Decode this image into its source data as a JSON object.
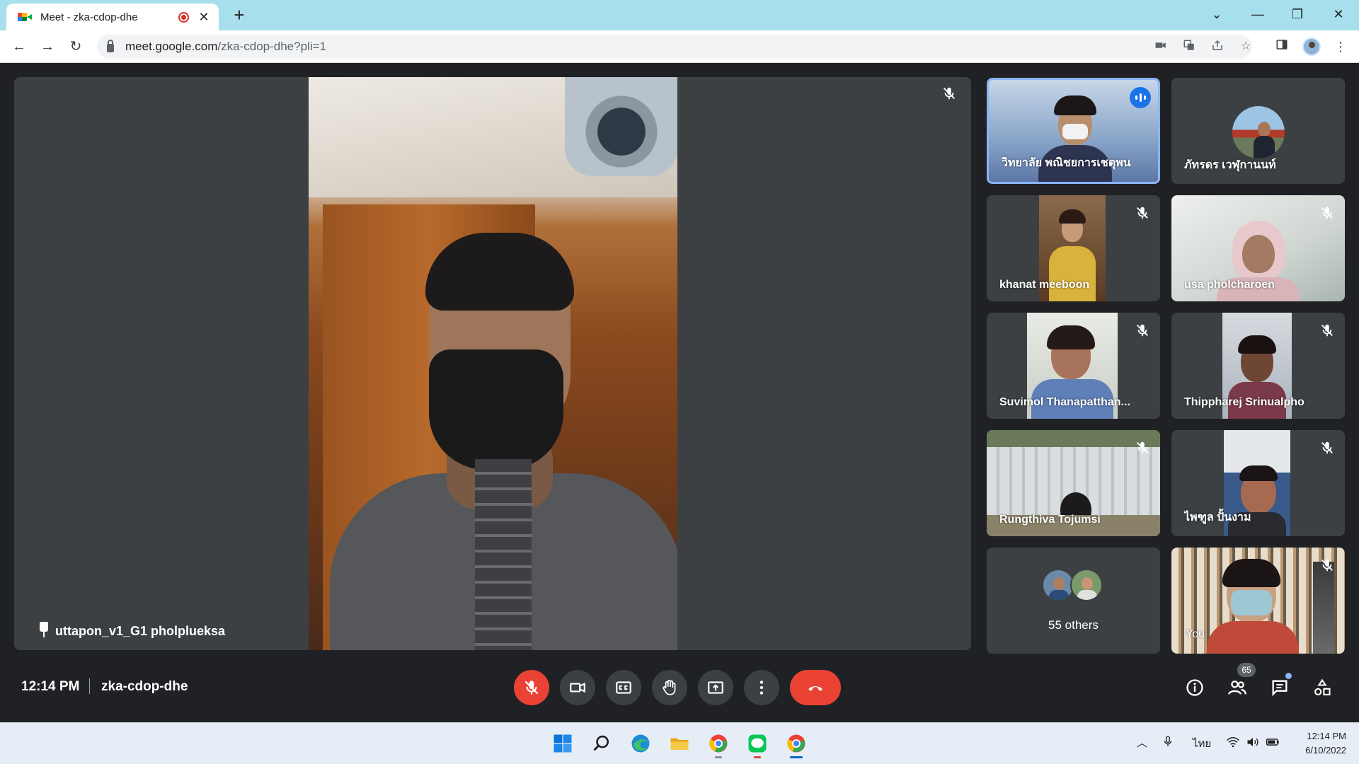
{
  "browser": {
    "tab_title": "Meet - zka-cdop-dhe",
    "new_tab_symbol": "+",
    "url_host": "meet.google.com",
    "url_path": "/zka-cdop-dhe?pli=1"
  },
  "main_speaker": {
    "name": "uttapon_v1_G1 pholplueksa"
  },
  "participants": [
    {
      "name": "วิทยาลัย พณิชยการเชตุพน",
      "speaking": true
    },
    {
      "name": "ภัทรดร เวฬุกานนท์"
    },
    {
      "name": "khanat meeboon",
      "muted": true
    },
    {
      "name": "usa pholcharoen",
      "muted": true
    },
    {
      "name": "Suvimol Thanapatthan...",
      "muted": true
    },
    {
      "name": "Thippharej Srinualpho",
      "muted": true
    },
    {
      "name": "Rungthiva Tojumsi",
      "muted": true
    },
    {
      "name": "ไพฑูล ปั้นงาม",
      "muted": true
    }
  ],
  "others": {
    "label": "55 others"
  },
  "self_tile": {
    "name": "You"
  },
  "meeting": {
    "time": "12:14 PM",
    "code": "zka-cdop-dhe",
    "participant_count": "65"
  },
  "taskbar": {
    "language": "ไทย",
    "time": "12:14 PM",
    "date": "6/10/2022"
  },
  "colors": {
    "tab_strip": "#a8dfec",
    "meet_bg": "#202124",
    "tile_bg": "#3c4043",
    "danger": "#ea4335",
    "accent": "#1a73e8"
  }
}
